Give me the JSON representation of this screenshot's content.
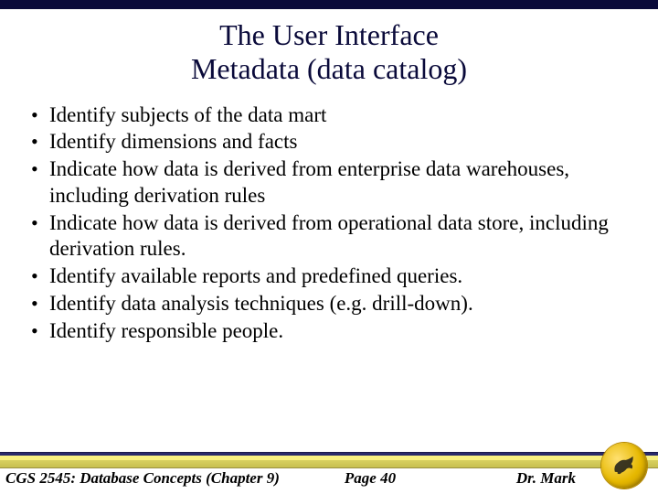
{
  "title_line1": "The User Interface",
  "title_line2": "Metadata (data catalog)",
  "bullets": [
    "Identify subjects of the data mart",
    "Identify dimensions and facts",
    "Indicate how data is derived from enterprise data warehouses, including derivation rules",
    "Indicate how data is derived from operational data store, including derivation rules.",
    "Identify available reports and predefined queries.",
    "Identify data analysis techniques (e.g. drill-down).",
    "Identify responsible people."
  ],
  "footer": {
    "left": "CGS 2545: Database Concepts  (Chapter 9)",
    "center": "Page 40",
    "right": "Dr. Mark"
  }
}
